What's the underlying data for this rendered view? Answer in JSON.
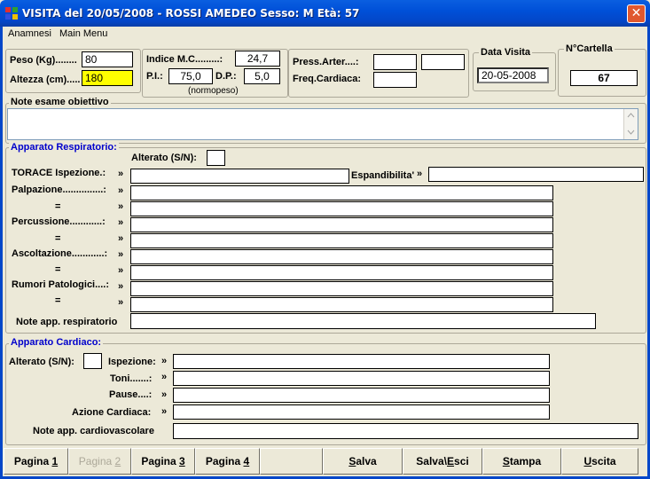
{
  "window": {
    "title": "VISITA del 20/05/2008  -  ROSSI AMEDEO Sesso: M Età: 57",
    "close_glyph": "✕"
  },
  "menu": {
    "items": [
      "Anamnesi",
      "Main Menu"
    ]
  },
  "biometrics": {
    "peso_label": "Peso (Kg)........",
    "peso_value": "80",
    "altezza_label": "Altezza (cm).....",
    "altezza_value": "180",
    "imc_label": "Indice M.C.........:",
    "imc_value": "24,7",
    "pi_label": "P.I.:",
    "pi_value": "75,0",
    "dp_label": "D.P.:",
    "dp_value": "5,0",
    "status": "(normopeso)"
  },
  "vitals": {
    "press_label": "Press.Arter....:",
    "freq_label": "Freq.Cardiaca:",
    "press_min": "",
    "press_max": "",
    "freq_value": ""
  },
  "visit": {
    "data_label": "Data Visita",
    "data_value": "20-05-2008",
    "cartella_label": "N°Cartella",
    "cartella_value": "67"
  },
  "note_esame": {
    "label": "Note esame obiettivo",
    "value": ""
  },
  "respiratorio": {
    "title": "Apparato Respiratorio:",
    "alterato_label": "Alterato (S/N):",
    "alterato_value": "",
    "torace_label": "TORACE Ispezione.:",
    "espandibilita_label": "Espandibilita'",
    "rows": [
      {
        "label": "Palpazione...............:",
        "value": ""
      },
      {
        "label": "=",
        "value": ""
      },
      {
        "label": "Percussione............:",
        "value": ""
      },
      {
        "label": "=",
        "value": ""
      },
      {
        "label": "Ascoltazione............:",
        "value": ""
      },
      {
        "label": "=",
        "value": ""
      },
      {
        "label": "Rumori Patologici....:",
        "value": ""
      },
      {
        "label": "=",
        "value": ""
      }
    ],
    "note_label": "Note app. respiratorio",
    "note_value": ""
  },
  "cardiaco": {
    "title": "Apparato Cardiaco:",
    "alterato_label": "Alterato (S/N):",
    "ispezione_label": "Ispezione:",
    "toni_label": "Toni.......:",
    "pause_label": "Pause....:",
    "azione_label": "Azione Cardiaca:",
    "note_label": "Note app. cardiovascolare"
  },
  "arrow_glyph": "»",
  "buttons": [
    {
      "pre": "Pagina ",
      "u": "1",
      "post": "",
      "enabled": true
    },
    {
      "pre": "Pagina ",
      "u": "2",
      "post": "",
      "enabled": false
    },
    {
      "pre": "Pagina ",
      "u": "3",
      "post": "",
      "enabled": true
    },
    {
      "pre": "Pagina ",
      "u": "4",
      "post": "",
      "enabled": true
    },
    {
      "pre": "",
      "u": "S",
      "post": "alva",
      "enabled": true
    },
    {
      "pre": "Salva\\",
      "u": "E",
      "post": "sci",
      "enabled": true
    },
    {
      "pre": "",
      "u": "S",
      "post": "tampa",
      "enabled": true
    },
    {
      "pre": "",
      "u": "U",
      "post": "scita",
      "enabled": true
    }
  ]
}
